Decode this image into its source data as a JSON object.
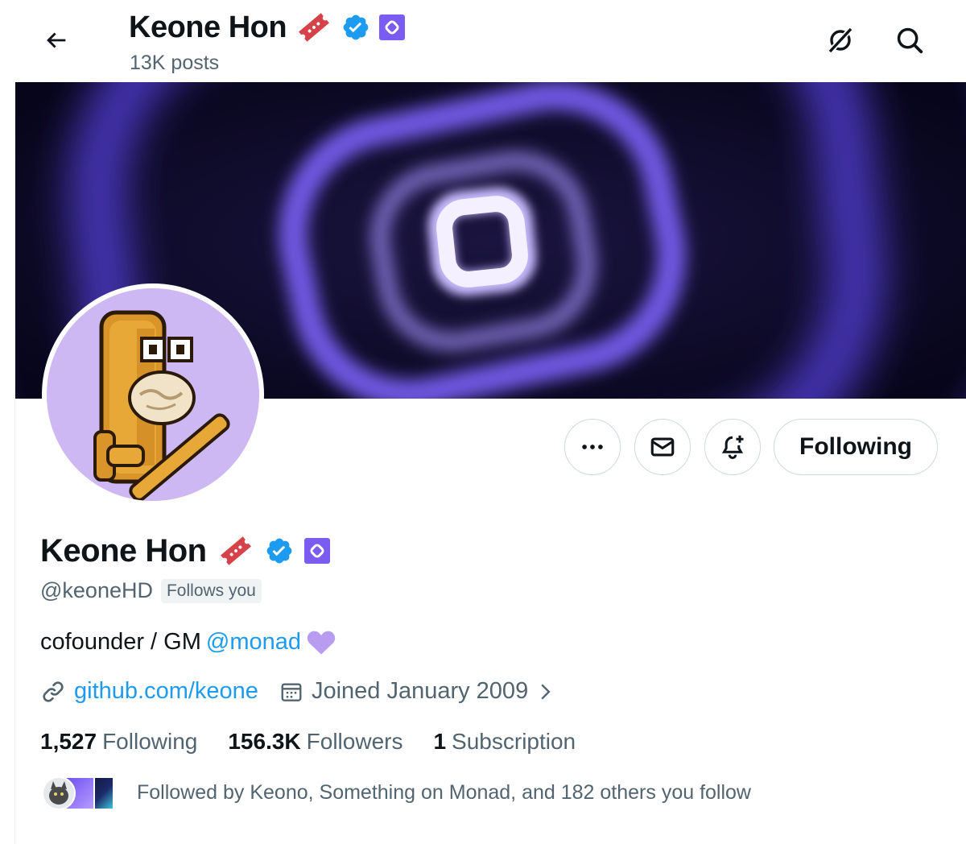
{
  "header": {
    "name": "Keone Hon",
    "posts": "13K posts"
  },
  "actions": {
    "following_label": "Following"
  },
  "profile": {
    "name": "Keone Hon",
    "handle": "@keoneHD",
    "follows_you": "Follows you",
    "bio_text": "cofounder / GM",
    "bio_mention": "@monad",
    "website": "github.com/keone",
    "joined": "Joined January 2009"
  },
  "stats": {
    "following_count": "1,527",
    "following_label": "Following",
    "followers_count": "156.3K",
    "followers_label": "Followers",
    "subscriptions_count": "1",
    "subscriptions_label": "Subscription"
  },
  "followed_by": "Followed by Keono, Something on Monad, and 182 others you follow",
  "icons": {
    "back": "arrow-left-icon",
    "grok": "grok-icon",
    "search": "search-icon",
    "more": "more-icon",
    "message": "mail-icon",
    "notify": "bell-plus-icon",
    "link": "link-icon",
    "calendar": "calendar-icon",
    "ticket": "ticket-icon",
    "verified": "verified-badge-icon",
    "affiliate": "monad-affiliate-icon",
    "heart": "purple-heart-icon"
  },
  "colors": {
    "verified": "#1d9bf0",
    "affiliate": "#7b5cf0",
    "ticket": "#d6424a",
    "heart": "#b79cf0",
    "banner_glow": "#6a4df2"
  }
}
